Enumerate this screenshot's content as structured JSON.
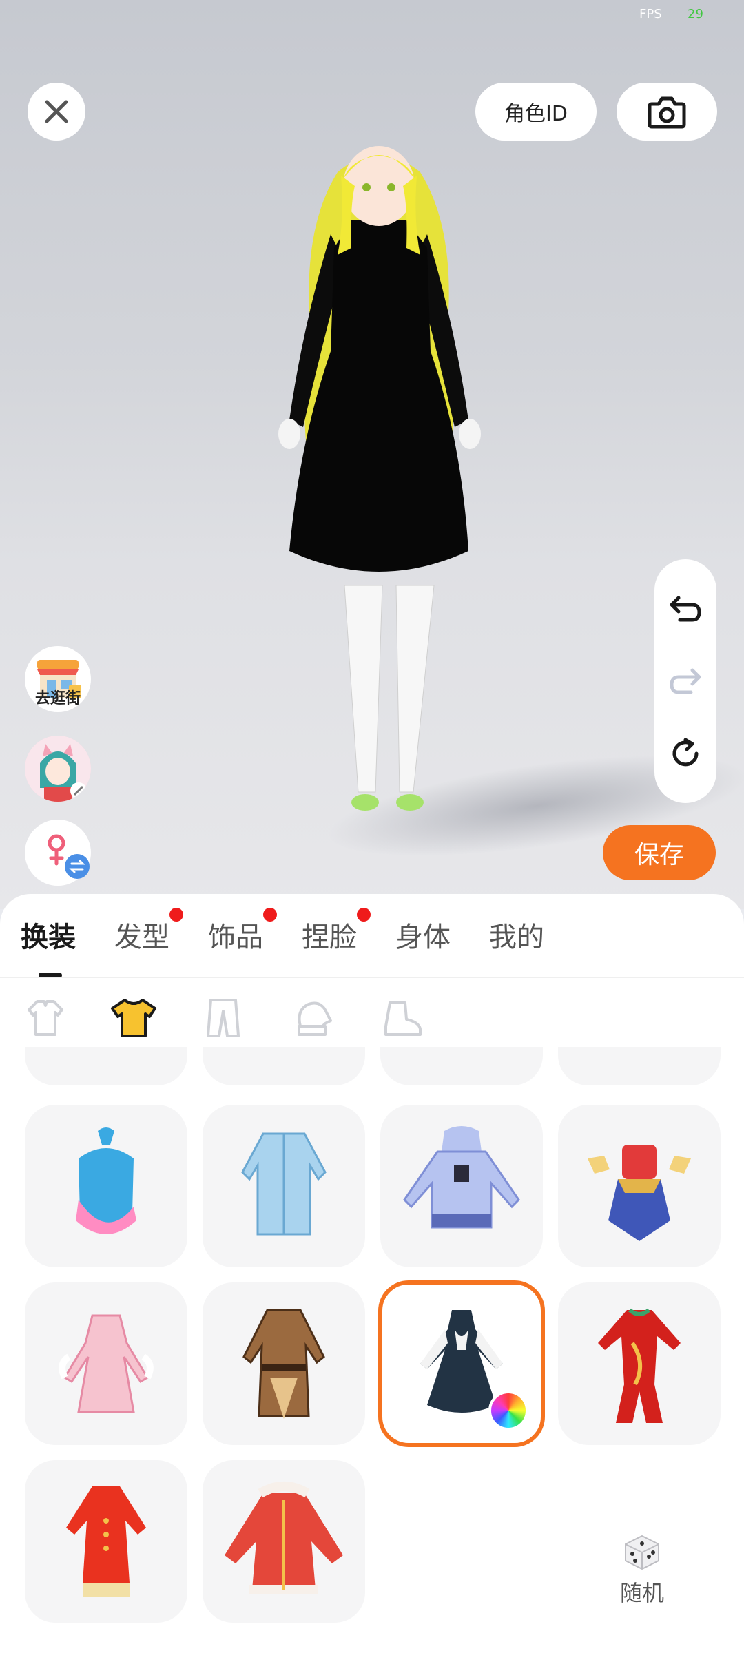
{
  "status": {
    "fps_label": "FPS",
    "fps_value": "29"
  },
  "header": {
    "close_icon": "close-icon",
    "role_id_label": "角色ID",
    "camera_icon": "camera-icon"
  },
  "side_tools": {
    "shop_label": "去逛街",
    "shop_icon": "shop-icon",
    "avatar_icon": "avatar-icon",
    "gender_icon": "female-icon"
  },
  "history": {
    "undo_icon": "undo-icon",
    "redo_icon": "redo-icon",
    "reset_icon": "reset-icon"
  },
  "save_label": "保存",
  "tabs": [
    {
      "label": "换装",
      "active": true,
      "dot": false
    },
    {
      "label": "发型",
      "active": false,
      "dot": true
    },
    {
      "label": "饰品",
      "active": false,
      "dot": true
    },
    {
      "label": "捏脸",
      "active": false,
      "dot": true
    },
    {
      "label": "身体",
      "active": false,
      "dot": false
    },
    {
      "label": "我的",
      "active": false,
      "dot": false
    }
  ],
  "subcategories": [
    {
      "icon": "suit-icon",
      "active": false
    },
    {
      "icon": "shirt-icon",
      "active": true
    },
    {
      "icon": "pants-icon",
      "active": false
    },
    {
      "icon": "gloves-icon",
      "active": false
    },
    {
      "icon": "shoes-icon",
      "active": false
    }
  ],
  "outfits": [
    {
      "name": "blue-halter-top",
      "selected": false
    },
    {
      "name": "light-blue-coat",
      "selected": false
    },
    {
      "name": "blue-hoodie-dress",
      "selected": false
    },
    {
      "name": "red-hero-armor",
      "selected": false
    },
    {
      "name": "pink-ruffle-dress",
      "selected": false
    },
    {
      "name": "brown-trench-coat",
      "selected": true,
      "color_editable": true
    },
    {
      "name": "red-dragon-qipao",
      "selected": false
    },
    {
      "name": "red-knit-dress",
      "selected": false
    },
    {
      "name": "red-fur-coat",
      "selected": false
    }
  ],
  "random": {
    "icon": "dice-icon",
    "label": "随机"
  },
  "colors": {
    "accent": "#f57320",
    "dot": "#ef1b1b",
    "card": "#f5f5f6"
  }
}
